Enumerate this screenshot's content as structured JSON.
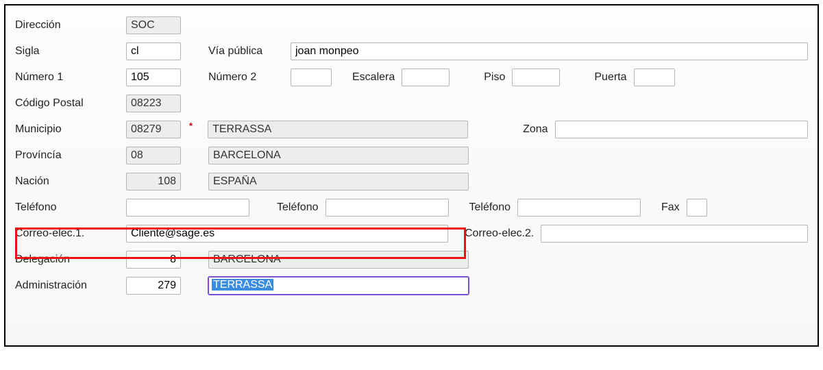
{
  "labels": {
    "direccion": "Dirección",
    "sigla": "Sigla",
    "via_publica": "Vía pública",
    "numero1": "Número 1",
    "numero2": "Número 2",
    "escalera": "Escalera",
    "piso": "Piso",
    "puerta": "Puerta",
    "codigo_postal": "Código Postal",
    "municipio": "Municipio",
    "zona": "Zona",
    "provincia": "Províncía",
    "nacion": "Nación",
    "telefono": "Teléfono",
    "fax": "Fax",
    "correo1": "Correo-elec.1.",
    "correo2": "Correo-elec.2.",
    "delegacion": "Delegación",
    "administracion": "Administración"
  },
  "values": {
    "direccion": "SOC",
    "sigla": "cl",
    "via_publica": "joan monpeo",
    "numero1": "105",
    "numero2": "",
    "escalera": "",
    "piso": "",
    "puerta": "",
    "codigo_postal": "08223",
    "municipio_code": "08279",
    "municipio_name": "TERRASSA",
    "zona": "",
    "provincia_code": "08",
    "provincia_name": "BARCELONA",
    "nacion_code": "108",
    "nacion_name": "ESPAÑA",
    "telefono1": "",
    "telefono2": "",
    "telefono3": "",
    "fax": "",
    "correo1": "Cliente@sage.es",
    "correo2": "",
    "delegacion_code": "8",
    "delegacion_name": "BARCELONA",
    "administracion_code": "279",
    "administracion_name": "TERRASSA"
  }
}
